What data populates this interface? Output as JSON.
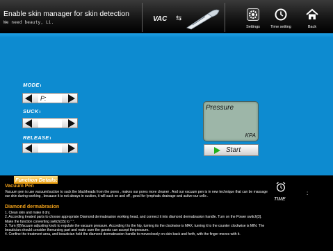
{
  "header": {
    "title": "Enable skin manager for skin detection",
    "subtitle": "We need beauty, Li.",
    "mode_label": "VAC",
    "buttons": {
      "settings": "Settings",
      "time_setting": "Time setting",
      "back": "Back"
    }
  },
  "params": {
    "mode": {
      "label": "MODE",
      "value": "P:"
    },
    "suck": {
      "label": "SUCK",
      "value": ""
    },
    "release": {
      "label": "RELEASE",
      "value": ""
    }
  },
  "pressure": {
    "title": "Pressure",
    "unit": "KPA"
  },
  "start_label": "Start",
  "functions": {
    "heading": "Function Details:",
    "vacuum_pen_title": "Vacuum Pen",
    "vacuum_pen_text": "Vacuum pen is use vacuum/suction to suck the blackheads from the pores , makes our pores more cleaner . And our vacuum pen is in new technique that can be massage our skin during working , because it is not always in suction, it will suck on and off , good for lymphatic drainage and active our cells .",
    "diamond_title": "Diamond dermabrasion",
    "diamond_steps": [
      "1. Clean skin and make it dry.",
      "2. According treated parts to choose appropriate Diamond dermabrasion working head, and connect it into diamond dermabrasion handle. Turn on the Power switch[3]. Make the function converting switch[15] to \" \".",
      "3. Turn [6]Vacuum adjusting knob to regulate the vacuum pressure. According t to the hip, turning ito the clockwise is MAX, turning it to the counter clockwise is MIN. The beautician should consider thenursing part and make sure the guests can accept thepressure.",
      "4. Confine the treatment area, and beautician hold the diamond dermabrasion handle to moveclosely on skin back and forth, with the finger moves with it."
    ]
  },
  "timer": {
    "label": "TIME",
    "separator": ":"
  }
}
